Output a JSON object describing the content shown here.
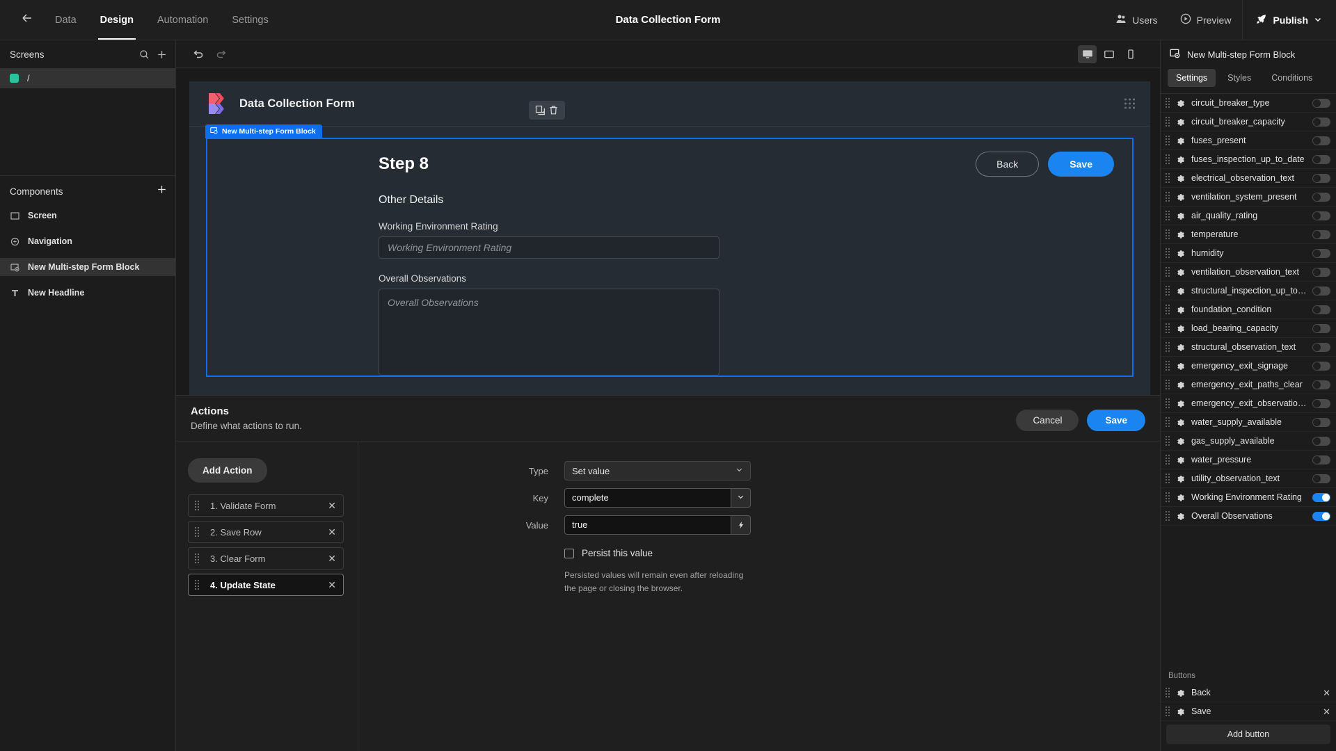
{
  "topbar": {
    "back_icon": "arrow-left-icon",
    "tabs": [
      {
        "label": "Data",
        "active": false
      },
      {
        "label": "Design",
        "active": true
      },
      {
        "label": "Automation",
        "active": false
      },
      {
        "label": "Settings",
        "active": false
      }
    ],
    "app_title": "Data Collection Form",
    "users_label": "Users",
    "preview_label": "Preview",
    "publish_label": "Publish"
  },
  "left_panel": {
    "screens_title": "Screens",
    "search_icon": "search-icon",
    "add_icon": "plus-icon",
    "screens": [
      {
        "name": "/",
        "selected": true
      }
    ],
    "components_title": "Components",
    "components_add_icon": "plus-icon",
    "components": [
      {
        "label": "Screen",
        "icon": "screen-icon",
        "selected": false
      },
      {
        "label": "Navigation",
        "icon": "navigation-icon",
        "selected": false
      },
      {
        "label": "New Multi-step Form Block",
        "icon": "form-block-icon",
        "selected": true
      },
      {
        "label": "New Headline",
        "icon": "text-icon",
        "selected": false
      }
    ]
  },
  "center": {
    "undo_icon": "undo-icon",
    "redo_icon": "redo-icon",
    "devices": [
      {
        "name": "desktop-icon",
        "active": true
      },
      {
        "name": "tablet-icon",
        "active": false
      },
      {
        "name": "mobile-icon",
        "active": false
      }
    ],
    "canvas": {
      "form_title": "Data Collection Form",
      "header_tools": [
        "duplicate-icon",
        "delete-icon"
      ],
      "selection_tag": "New Multi-step Form Block",
      "step_title": "Step 8",
      "back_label": "Back",
      "save_label": "Save",
      "section_title": "Other Details",
      "fields": [
        {
          "label": "Working Environment Rating",
          "placeholder": "Working Environment Rating",
          "type": "text"
        },
        {
          "label": "Overall Observations",
          "placeholder": "Overall Observations",
          "type": "textarea"
        }
      ]
    }
  },
  "actions_panel": {
    "title": "Actions",
    "subtitle": "Define what actions to run.",
    "cancel_label": "Cancel",
    "save_label": "Save",
    "add_action_label": "Add Action",
    "actions": [
      {
        "label": "1. Validate Form",
        "selected": false
      },
      {
        "label": "2. Save Row",
        "selected": false
      },
      {
        "label": "3. Clear Form",
        "selected": false
      },
      {
        "label": "4. Update State",
        "selected": true
      }
    ],
    "config": {
      "type_label": "Type",
      "type_value": "Set value",
      "key_label": "Key",
      "key_value": "complete",
      "value_label": "Value",
      "value_value": "true",
      "binding_icon": "lightning-icon",
      "persist_label": "Persist this value",
      "persist_checked": false,
      "persist_help": "Persisted values will remain even after reloading the page or closing the browser."
    }
  },
  "right_panel": {
    "component_icon": "form-block-icon",
    "component_name": "New Multi-step Form Block",
    "tabs": [
      {
        "label": "Settings",
        "active": true
      },
      {
        "label": "Styles",
        "active": false
      },
      {
        "label": "Conditions",
        "active": false
      }
    ],
    "fields": [
      {
        "name": "circuit_breaker_type",
        "on": false
      },
      {
        "name": "circuit_breaker_capacity",
        "on": false
      },
      {
        "name": "fuses_present",
        "on": false
      },
      {
        "name": "fuses_inspection_up_to_date",
        "on": false
      },
      {
        "name": "electrical_observation_text",
        "on": false
      },
      {
        "name": "ventilation_system_present",
        "on": false
      },
      {
        "name": "air_quality_rating",
        "on": false
      },
      {
        "name": "temperature",
        "on": false
      },
      {
        "name": "humidity",
        "on": false
      },
      {
        "name": "ventilation_observation_text",
        "on": false
      },
      {
        "name": "structural_inspection_up_to…",
        "on": false
      },
      {
        "name": "foundation_condition",
        "on": false
      },
      {
        "name": "load_bearing_capacity",
        "on": false
      },
      {
        "name": "structural_observation_text",
        "on": false
      },
      {
        "name": "emergency_exit_signage",
        "on": false
      },
      {
        "name": "emergency_exit_paths_clear",
        "on": false
      },
      {
        "name": "emergency_exit_observatio…",
        "on": false
      },
      {
        "name": "water_supply_available",
        "on": false
      },
      {
        "name": "gas_supply_available",
        "on": false
      },
      {
        "name": "water_pressure",
        "on": false
      },
      {
        "name": "utility_observation_text",
        "on": false
      },
      {
        "name": "Working Environment Rating",
        "on": true
      },
      {
        "name": "Overall Observations",
        "on": true
      }
    ],
    "buttons_section_label": "Buttons",
    "buttons": [
      {
        "name": "Back"
      },
      {
        "name": "Save"
      }
    ],
    "add_button_label": "Add button"
  },
  "colors": {
    "accent_blue": "#1a84f0",
    "selection_blue": "#0d6ff0",
    "screen_dot_green": "#2bc39b"
  }
}
